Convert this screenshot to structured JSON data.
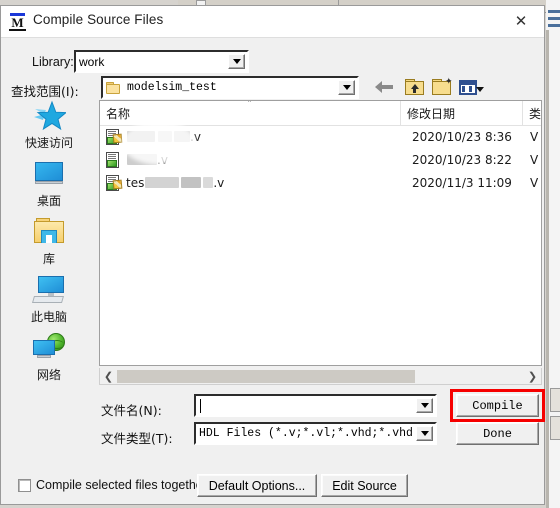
{
  "window": {
    "title": "Compile Source Files",
    "logo_letter": "M",
    "close_label": "✕"
  },
  "form": {
    "library_label": "Library:",
    "library_value": "work",
    "lookin_label": "查找范围(I):",
    "lookin_value": "modelsim_test",
    "filename_label": "文件名(N):",
    "filename_value": "",
    "filetype_label": "文件类型(T):",
    "filetype_value": "HDL Files (*.v;*.vl;*.vhd;*.vhdl;*.vh",
    "checkbox_label": "Compile selected files together",
    "checkbox_checked": false
  },
  "toolbar": {
    "back_icon": "back-arrow-icon",
    "up_icon": "up-one-level-icon",
    "new_folder_icon": "new-folder-icon",
    "views_icon": "change-view-icon"
  },
  "places": [
    {
      "label": "快速访问",
      "icon": "star-icon",
      "name": "quick-access"
    },
    {
      "label": "桌面",
      "icon": "monitor-icon",
      "name": "desktop"
    },
    {
      "label": "库",
      "icon": "library-folder-icon",
      "name": "libraries"
    },
    {
      "label": "此电脑",
      "icon": "this-pc-icon",
      "name": "this-pc"
    },
    {
      "label": "网络",
      "icon": "network-globe-icon",
      "name": "network"
    }
  ],
  "filelist": {
    "columns": [
      "名称",
      "修改日期",
      "类"
    ],
    "sort_indicator": "˄",
    "rows": [
      {
        "name_prefix": "",
        "name_suffix": ".v",
        "redacted": true,
        "date": "2020/10/23 8:36",
        "type": "V"
      },
      {
        "name_prefix": "",
        "name_suffix": ".v",
        "redacted": true,
        "date": "2020/10/23 8:22",
        "type": "V"
      },
      {
        "name_prefix": "tes",
        "name_suffix": ".v",
        "redacted": true,
        "date": "2020/11/3 11:09",
        "type": "V"
      }
    ]
  },
  "buttons": {
    "compile": "Compile",
    "done": "Done",
    "default_options": "Default Options...",
    "edit_source": "Edit Source"
  },
  "highlight": {
    "target": "compile-button",
    "color": "#f60000"
  }
}
